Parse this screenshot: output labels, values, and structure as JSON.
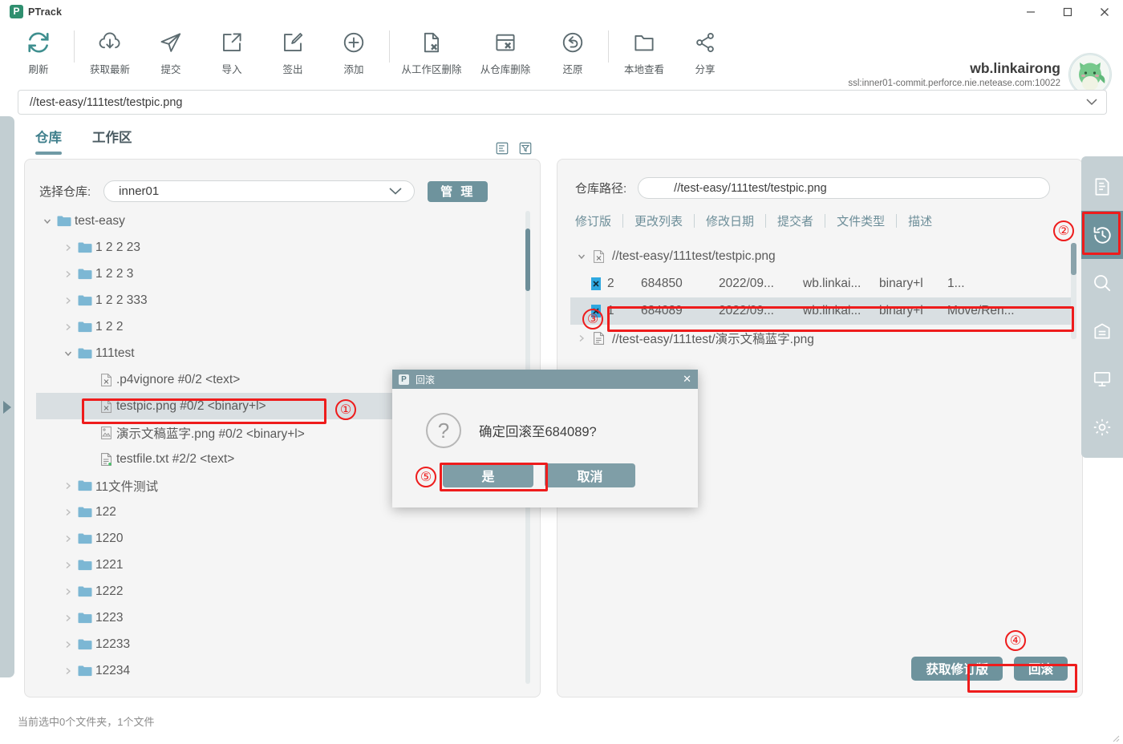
{
  "window": {
    "app_name": "PTrack",
    "logo_glyph": "P",
    "minimize": "—",
    "maximize": "☐",
    "close": "✕"
  },
  "toolbar": {
    "items": [
      {
        "label": "刷新",
        "icon": "refresh-icon"
      },
      {
        "label": "获取最新",
        "icon": "download-cloud-icon"
      },
      {
        "label": "提交",
        "icon": "send-paperplane-icon"
      },
      {
        "label": "导入",
        "icon": "import-arrow-icon"
      },
      {
        "label": "签出",
        "icon": "edit-checkout-icon"
      },
      {
        "label": "添加",
        "icon": "plus-circle-icon"
      },
      {
        "label": "从工作区删除",
        "icon": "file-delete-icon"
      },
      {
        "label": "从仓库删除",
        "icon": "archive-delete-icon"
      },
      {
        "label": "还原",
        "icon": "revert-undo-icon"
      },
      {
        "label": "本地查看",
        "icon": "folder-open-icon"
      },
      {
        "label": "分享",
        "icon": "share-icon"
      }
    ],
    "user_name": "wb.linkairong",
    "user_host": "ssl:inner01-commit.perforce.nie.netease.com:10022"
  },
  "pathbar": {
    "value": "//test-easy/111test/testpic.png",
    "chevron": "⌄"
  },
  "tabs": [
    {
      "label": "仓库",
      "active": true
    },
    {
      "label": "工作区",
      "active": false
    }
  ],
  "tab_icons": [
    {
      "name": "sort-list-icon"
    },
    {
      "name": "filter-icon"
    }
  ],
  "left_panel": {
    "repo_label": "选择仓库:",
    "repo_value": "inner01",
    "manage_button": "管 理",
    "tree": [
      {
        "depth": 0,
        "twisty": "down",
        "icon": "folder",
        "label": "test-easy"
      },
      {
        "depth": 1,
        "twisty": "right",
        "icon": "folder",
        "label": "1 2 2 23"
      },
      {
        "depth": 1,
        "twisty": "right",
        "icon": "folder",
        "label": "1 2 2 3"
      },
      {
        "depth": 1,
        "twisty": "right",
        "icon": "folder",
        "label": "1 2 2 333"
      },
      {
        "depth": 1,
        "twisty": "right",
        "icon": "folder",
        "label": "1 2 2"
      },
      {
        "depth": 1,
        "twisty": "down",
        "icon": "folder",
        "label": "111test"
      },
      {
        "depth": 2,
        "twisty": "none",
        "icon": "file-binary",
        "label": ".p4vignore  #0/2 <text>"
      },
      {
        "depth": 2,
        "twisty": "none",
        "icon": "file-binary",
        "label": "testpic.png  #0/2 <binary+l>",
        "selected": true
      },
      {
        "depth": 2,
        "twisty": "none",
        "icon": "file-image",
        "label": "演示文稿蓝字.png  #0/2 <binary+l>"
      },
      {
        "depth": 2,
        "twisty": "none",
        "icon": "file-text",
        "label": "testfile.txt  #2/2 <text>"
      },
      {
        "depth": 1,
        "twisty": "right",
        "icon": "folder",
        "label": "11文件测试"
      },
      {
        "depth": 1,
        "twisty": "right",
        "icon": "folder",
        "label": "122"
      },
      {
        "depth": 1,
        "twisty": "right",
        "icon": "folder",
        "label": "1220"
      },
      {
        "depth": 1,
        "twisty": "right",
        "icon": "folder",
        "label": "1221"
      },
      {
        "depth": 1,
        "twisty": "right",
        "icon": "folder",
        "label": "1222"
      },
      {
        "depth": 1,
        "twisty": "right",
        "icon": "folder",
        "label": "1223"
      },
      {
        "depth": 1,
        "twisty": "right",
        "icon": "folder",
        "label": "12233"
      },
      {
        "depth": 1,
        "twisty": "right",
        "icon": "folder",
        "label": "12234"
      }
    ]
  },
  "right_panel": {
    "path_label": "仓库路径:",
    "path_value": "//test-easy/111test/testpic.png",
    "columns": [
      "修订版",
      "更改列表",
      "修改日期",
      "提交者",
      "文件类型",
      "描述"
    ],
    "rows": [
      {
        "kind": "group",
        "twisty": "down",
        "icon": "file-binary",
        "label": "//test-easy/111test/testpic.png"
      },
      {
        "kind": "rev",
        "icon": "rev-binary",
        "rev": "2",
        "changelist": "684850",
        "date": "2022/09...",
        "author": "wb.linkai...",
        "filetype": "binary+l",
        "desc": "1..."
      },
      {
        "kind": "rev",
        "icon": "rev-binary",
        "selected": true,
        "rev": "1",
        "changelist": "684089",
        "date": "2022/09...",
        "author": "wb.linkai...",
        "filetype": "binary+l",
        "desc": "Move/Ren..."
      },
      {
        "kind": "group",
        "twisty": "right",
        "icon": "file-text",
        "label": "//test-easy/111test/演示文稿蓝字.png"
      }
    ],
    "get_revision_button": "获取修订版",
    "rollback_button": "回滚"
  },
  "right_rail": [
    {
      "name": "notes-icon",
      "active": false
    },
    {
      "name": "history-icon",
      "active": true
    },
    {
      "name": "search-icon",
      "active": false
    },
    {
      "name": "archive-icon",
      "active": false
    },
    {
      "name": "monitor-icon",
      "active": false
    },
    {
      "name": "gear-icon",
      "active": false
    }
  ],
  "dialog": {
    "title": "回滚",
    "logo_glyph": "P",
    "close": "✕",
    "question_mark": "?",
    "message": "确定回滚至684089?",
    "confirm_button": "是",
    "cancel_button": "取消"
  },
  "status_bar": {
    "text": "当前选中0个文件夹，1个文件"
  },
  "annotations": [
    {
      "num": "①"
    },
    {
      "num": "②"
    },
    {
      "num": "③"
    },
    {
      "num": "④"
    },
    {
      "num": "⑤"
    }
  ],
  "colors": {
    "accent": "#6e939d",
    "rail": "#c5d0d4",
    "selection": "#d9dfe2",
    "annotation_red": "#ee1c1c",
    "folder_blue": "#7cb7d4",
    "panel_bg": "#f5f5f5"
  }
}
